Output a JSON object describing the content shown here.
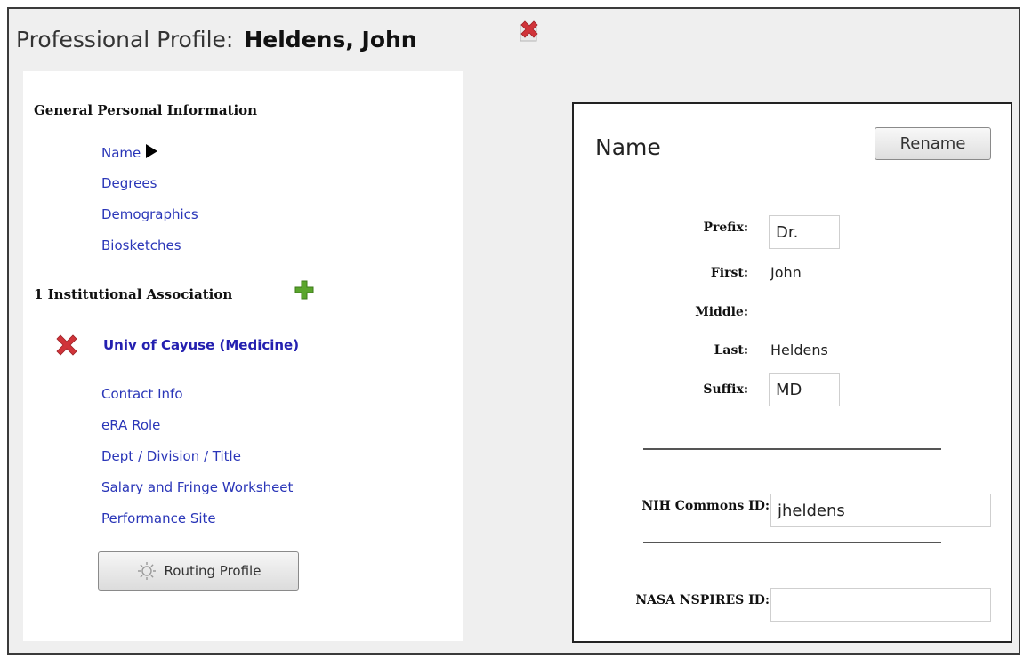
{
  "header": {
    "prefix": "Professional Profile:",
    "person_name": "Heldens, John",
    "close_icon": "delete-x-icon"
  },
  "sidebar": {
    "general_heading": "General Personal Information",
    "general_items": [
      {
        "label": "Name",
        "current": true
      },
      {
        "label": "Degrees"
      },
      {
        "label": "Demographics"
      },
      {
        "label": "Biosketches"
      }
    ],
    "institutional_heading": "1 Institutional Association",
    "add_icon": "green-plus-icon",
    "institution": {
      "label": "Univ of Cayuse (Medicine)",
      "remove_icon": "red-x-icon"
    },
    "institution_items": [
      {
        "label": "Contact Info"
      },
      {
        "label": "eRA Role"
      },
      {
        "label": "Dept / Division / Title"
      },
      {
        "label": "Salary and Fringe Worksheet"
      },
      {
        "label": "Performance Site"
      }
    ],
    "routing_button": {
      "label": "Routing Profile",
      "icon": "gear-icon"
    }
  },
  "name_panel": {
    "title": "Name",
    "rename_label": "Rename",
    "fields": {
      "prefix": {
        "label": "Prefix:",
        "value": "Dr."
      },
      "first": {
        "label": "First:",
        "value": "John"
      },
      "middle": {
        "label": "Middle:",
        "value": ""
      },
      "last": {
        "label": "Last:",
        "value": "Heldens"
      },
      "suffix": {
        "label": "Suffix:",
        "value": "MD"
      }
    },
    "nih_commons": {
      "label": "NIH Commons ID:",
      "value": "jheldens"
    },
    "nasa_nspires": {
      "label": "NASA NSPIRES ID:",
      "value": ""
    }
  },
  "colors": {
    "link": "#2a36b8",
    "background": "#efefef",
    "delete_red": "#d0343a",
    "add_green": "#5aa52c"
  }
}
